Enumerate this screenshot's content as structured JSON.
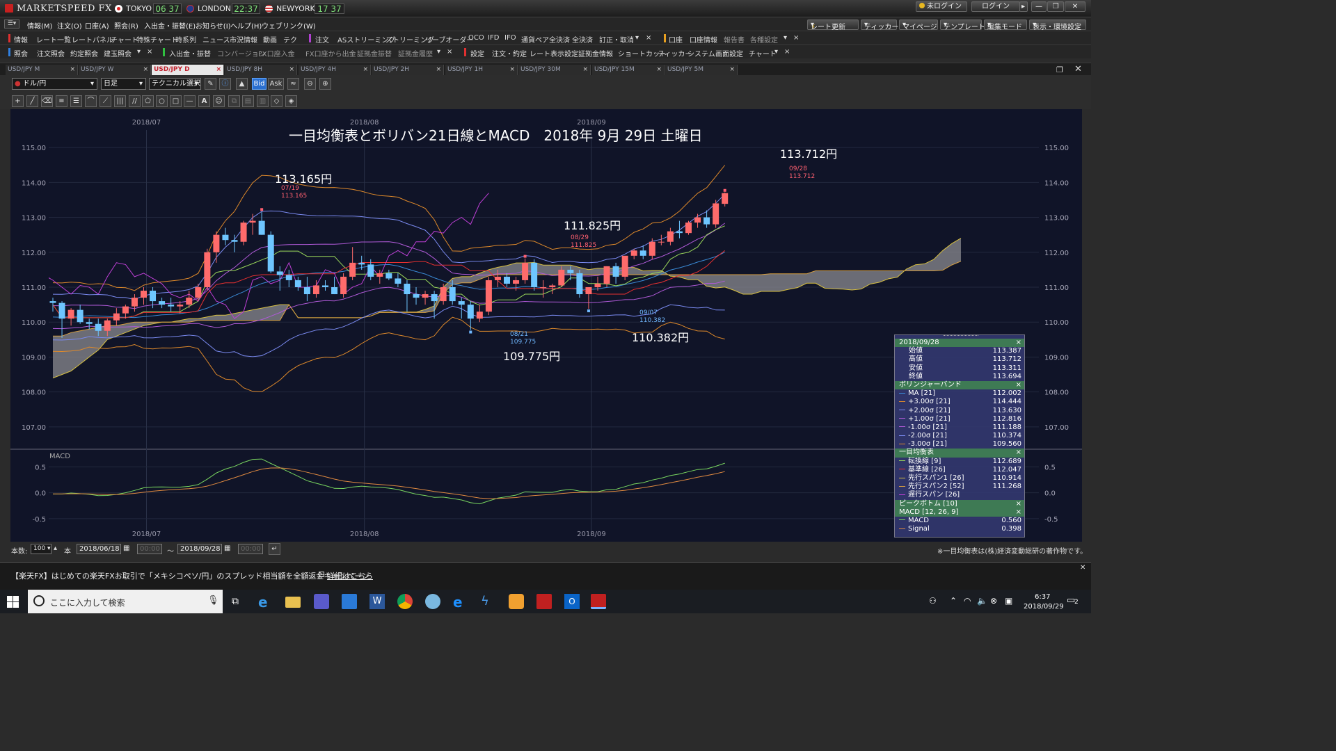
{
  "app": {
    "logo": "MARKETSPEED FX",
    "clocks": [
      {
        "city": "TOKYO",
        "time": "06 37"
      },
      {
        "city": "LONDON",
        "time": "22:37"
      },
      {
        "city": "NEWYORK",
        "time": "17 37"
      }
    ],
    "login_status": "未ログイン",
    "login_button": "ログイン"
  },
  "menubar": [
    "情報(M)",
    "注文(O)",
    "口座(A)",
    "照会(R)",
    "入出金・振替(E)",
    "お知らせ(I)",
    "ヘルプ(H)",
    "ウェブリンク(W)"
  ],
  "menubar_right": [
    "レート更新",
    "ティッカー",
    "マイページ",
    "テンプレート",
    "編集モード",
    "表示・環境設定"
  ],
  "toolbar1": [
    "情報",
    "レート一覧",
    "レートパネル",
    "チャート",
    "特殊チャート",
    "時系列",
    "ニュース",
    "市況情報",
    "動画",
    "テク",
    "注文",
    "ASストリーミング",
    "ストリーミング",
    "リーブオーダー",
    "OCO",
    "IFD",
    "IFO",
    "通貨ペア全決済",
    "全決済",
    "訂正・取消",
    "口座",
    "口座情報",
    "報告書",
    "各種設定"
  ],
  "toolbar2": [
    "照会",
    "注文照会",
    "約定照会",
    "建玉照会",
    "入出金・振替",
    "コンバージョン",
    "FX口座入金",
    "FX口座から出金",
    "証拠金振替",
    "証拠金履歴",
    "設定",
    "注文・約定",
    "レート表示設定",
    "証拠金情報",
    "ショートカット",
    "ティッカー",
    "システム",
    "画面設定",
    "チャート"
  ],
  "tabs": [
    "USD/JPY M",
    "USD/JPY W",
    "USD/JPY D",
    "USD/JPY 8H",
    "USD/JPY 4H",
    "USD/JPY 2H",
    "USD/JPY 1H",
    "USD/JPY 30M",
    "USD/JPY 15M",
    "USD/JPY 5M"
  ],
  "active_tab": "USD/JPY D",
  "controls": {
    "pair": "ドル/円",
    "period": "日足",
    "technical": "テクニカル選択",
    "bid": "Bid",
    "ask": "Ask"
  },
  "chart_title": "一目均衡表とボリバン21日線とMACD　2018年 9月 29日 土曜日",
  "annotations": {
    "high_jul": {
      "big": "113.165円",
      "date": "07/19",
      "value": "113.165"
    },
    "high_aug": {
      "big": "111.825円",
      "date": "08/29",
      "value": "111.825"
    },
    "high_sep": {
      "big": "113.712円",
      "date": "09/28",
      "value": "113.712"
    },
    "low_aug": {
      "big": "109.775円",
      "date": "08/21",
      "value": "109.775"
    },
    "low_sep": {
      "big": "110.382円",
      "date": "09/07",
      "value": "110.382"
    }
  },
  "macd_label": "MACD",
  "footer_note": "※一目均衡表は(株)経済変動総研の著作物です。",
  "bottom": {
    "count_label": "本数:",
    "count": "100",
    "unit": "本",
    "from": "2018/06/18",
    "to": "2018/09/28",
    "time_placeholder": "00:00",
    "tilde": "～"
  },
  "news_ticker": "【楽天FX】はじめての楽天FXお取引で「メキシコペソ/円」のスプレッド相当額を全額返金キャンペーン",
  "news_link": "詳細はこちら",
  "taskbar": {
    "search_placeholder": "ここに入力して検索",
    "time": "6:37",
    "date": "2018/09/29",
    "notif": "2"
  },
  "info_panel": {
    "date": "2018/09/28",
    "ohlc": [
      {
        "label": "始値",
        "value": "113.387"
      },
      {
        "label": "高値",
        "value": "113.712"
      },
      {
        "label": "安値",
        "value": "113.311"
      },
      {
        "label": "終値",
        "value": "113.694"
      }
    ],
    "bb_title": "ボリンジャーバンド",
    "bb": [
      {
        "label": "MA [21]",
        "value": "112.002",
        "color": "#3a8ad6"
      },
      {
        "label": "+3.00σ [21]",
        "value": "114.444",
        "color": "#e08a2a"
      },
      {
        "label": "+2.00σ [21]",
        "value": "113.630",
        "color": "#7a8af0"
      },
      {
        "label": "+1.00σ [21]",
        "value": "112.816",
        "color": "#b05ad8"
      },
      {
        "label": "-1.00σ [21]",
        "value": "111.188",
        "color": "#b05ad8"
      },
      {
        "label": "-2.00σ [21]",
        "value": "110.374",
        "color": "#7a8af0"
      },
      {
        "label": "-3.00σ [21]",
        "value": "109.560",
        "color": "#e08a2a"
      }
    ],
    "ichi_title": "一目均衡表",
    "ichi": [
      {
        "label": "転換線 [9]",
        "value": "112.689",
        "color": "#9ad85a"
      },
      {
        "label": "基準線 [26]",
        "value": "112.047",
        "color": "#e83030"
      },
      {
        "label": "先行スパン1 [26]",
        "value": "110.914",
        "color": "#d8c040"
      },
      {
        "label": "先行スパン2 [52]",
        "value": "111.268",
        "color": "#d8a040"
      },
      {
        "label": "遅行スパン [26]",
        "value": "",
        "color": "#c040d8"
      }
    ],
    "pb_title": "ピークボトム [10]",
    "macd_title": "MACD [12, 26, 9]",
    "macd": [
      {
        "label": "MACD",
        "value": "0.560",
        "color": "#7ad860"
      },
      {
        "label": "Signal",
        "value": "0.398",
        "color": "#e08a40"
      }
    ]
  },
  "chart_data": {
    "type": "candlestick",
    "pair": "USD/JPY",
    "timeframe": "daily",
    "xaxis_labels": [
      "2018/07",
      "2018/08",
      "2018/09"
    ],
    "yaxis_ticks": [
      107.0,
      108.0,
      109.0,
      110.0,
      111.0,
      112.0,
      113.0,
      114.0,
      115.0
    ],
    "ylim": [
      106.5,
      115.5
    ],
    "macd_ticks": [
      0.5,
      0.0,
      -0.5
    ],
    "candles": [
      {
        "d": "06/18",
        "o": 110.6,
        "h": 110.7,
        "l": 110.3,
        "c": 110.55
      },
      {
        "d": "06/19",
        "o": 110.55,
        "h": 110.6,
        "l": 109.55,
        "c": 110.1
      },
      {
        "d": "06/20",
        "o": 110.1,
        "h": 110.4,
        "l": 109.9,
        "c": 110.35
      },
      {
        "d": "06/21",
        "o": 110.35,
        "h": 110.5,
        "l": 109.95,
        "c": 110.0
      },
      {
        "d": "06/22",
        "o": 110.0,
        "h": 110.1,
        "l": 109.8,
        "c": 109.95
      },
      {
        "d": "06/25",
        "o": 109.95,
        "h": 110.1,
        "l": 109.6,
        "c": 109.75
      },
      {
        "d": "06/26",
        "o": 109.75,
        "h": 110.1,
        "l": 109.6,
        "c": 110.05
      },
      {
        "d": "06/27",
        "o": 110.05,
        "h": 110.4,
        "l": 109.9,
        "c": 110.25
      },
      {
        "d": "06/28",
        "o": 110.25,
        "h": 110.5,
        "l": 110.1,
        "c": 110.45
      },
      {
        "d": "06/29",
        "o": 110.45,
        "h": 110.8,
        "l": 110.3,
        "c": 110.7
      },
      {
        "d": "07/02",
        "o": 110.7,
        "h": 111.0,
        "l": 110.5,
        "c": 110.9
      },
      {
        "d": "07/03",
        "o": 110.9,
        "h": 111.0,
        "l": 110.4,
        "c": 110.6
      },
      {
        "d": "07/04",
        "o": 110.6,
        "h": 110.7,
        "l": 110.4,
        "c": 110.5
      },
      {
        "d": "07/05",
        "o": 110.5,
        "h": 110.7,
        "l": 110.3,
        "c": 110.45
      },
      {
        "d": "07/06",
        "o": 110.45,
        "h": 110.6,
        "l": 110.25,
        "c": 110.5
      },
      {
        "d": "07/09",
        "o": 110.5,
        "h": 110.9,
        "l": 110.4,
        "c": 110.7
      },
      {
        "d": "07/10",
        "o": 110.7,
        "h": 111.1,
        "l": 110.6,
        "c": 111.0
      },
      {
        "d": "07/11",
        "o": 111.0,
        "h": 112.1,
        "l": 110.9,
        "c": 112.0
      },
      {
        "d": "07/12",
        "o": 112.0,
        "h": 112.6,
        "l": 111.7,
        "c": 112.5
      },
      {
        "d": "07/13",
        "o": 112.5,
        "h": 112.7,
        "l": 112.2,
        "c": 112.35
      },
      {
        "d": "07/16",
        "o": 112.35,
        "h": 112.5,
        "l": 112.0,
        "c": 112.3
      },
      {
        "d": "07/17",
        "o": 112.3,
        "h": 112.9,
        "l": 112.2,
        "c": 112.85
      },
      {
        "d": "07/18",
        "o": 112.85,
        "h": 113.1,
        "l": 112.5,
        "c": 112.9
      },
      {
        "d": "07/19",
        "o": 112.9,
        "h": 113.165,
        "l": 112.5,
        "c": 112.5
      },
      {
        "d": "07/20",
        "o": 112.5,
        "h": 112.6,
        "l": 111.4,
        "c": 111.45
      },
      {
        "d": "07/23",
        "o": 111.45,
        "h": 111.6,
        "l": 110.9,
        "c": 111.35
      },
      {
        "d": "07/24",
        "o": 111.35,
        "h": 111.5,
        "l": 111.0,
        "c": 111.2
      },
      {
        "d": "07/25",
        "o": 111.2,
        "h": 111.3,
        "l": 110.9,
        "c": 111.0
      },
      {
        "d": "07/26",
        "o": 111.0,
        "h": 111.3,
        "l": 110.6,
        "c": 110.8
      },
      {
        "d": "07/27",
        "o": 110.8,
        "h": 111.2,
        "l": 110.7,
        "c": 111.05
      },
      {
        "d": "07/30",
        "o": 111.05,
        "h": 111.2,
        "l": 110.9,
        "c": 111.0
      },
      {
        "d": "07/31",
        "o": 111.0,
        "h": 111.3,
        "l": 110.8,
        "c": 110.8
      },
      {
        "d": "08/01",
        "o": 110.8,
        "h": 111.4,
        "l": 110.7,
        "c": 111.3
      },
      {
        "d": "08/02",
        "o": 111.3,
        "h": 112.15,
        "l": 111.2,
        "c": 111.7
      },
      {
        "d": "08/03",
        "o": 111.7,
        "h": 111.9,
        "l": 111.5,
        "c": 111.65
      },
      {
        "d": "08/06",
        "o": 111.65,
        "h": 111.8,
        "l": 111.2,
        "c": 111.3
      },
      {
        "d": "08/07",
        "o": 111.3,
        "h": 111.5,
        "l": 111.1,
        "c": 111.4
      },
      {
        "d": "08/08",
        "o": 111.4,
        "h": 111.5,
        "l": 111.2,
        "c": 111.25
      },
      {
        "d": "08/09",
        "o": 111.25,
        "h": 111.4,
        "l": 111.0,
        "c": 111.1
      },
      {
        "d": "08/10",
        "o": 111.1,
        "h": 111.2,
        "l": 110.3,
        "c": 110.8
      },
      {
        "d": "08/13",
        "o": 110.8,
        "h": 111.0,
        "l": 110.5,
        "c": 110.7
      },
      {
        "d": "08/14",
        "o": 110.7,
        "h": 110.9,
        "l": 110.5,
        "c": 110.8
      },
      {
        "d": "08/15",
        "o": 110.8,
        "h": 110.9,
        "l": 110.1,
        "c": 110.6
      },
      {
        "d": "08/16",
        "o": 110.6,
        "h": 111.1,
        "l": 110.5,
        "c": 111.0
      },
      {
        "d": "08/17",
        "o": 111.0,
        "h": 111.2,
        "l": 110.5,
        "c": 110.6
      },
      {
        "d": "08/20",
        "o": 110.6,
        "h": 110.7,
        "l": 110.1,
        "c": 110.5
      },
      {
        "d": "08/21",
        "o": 110.5,
        "h": 110.6,
        "l": 109.775,
        "c": 110.1
      },
      {
        "d": "08/22",
        "o": 110.1,
        "h": 110.5,
        "l": 110.0,
        "c": 110.3
      },
      {
        "d": "08/23",
        "o": 110.3,
        "h": 111.3,
        "l": 110.2,
        "c": 111.2
      },
      {
        "d": "08/24",
        "o": 111.2,
        "h": 111.5,
        "l": 111.0,
        "c": 111.3
      },
      {
        "d": "08/27",
        "o": 111.3,
        "h": 111.4,
        "l": 111.0,
        "c": 111.1
      },
      {
        "d": "08/28",
        "o": 111.1,
        "h": 111.3,
        "l": 110.9,
        "c": 111.2
      },
      {
        "d": "08/29",
        "o": 111.2,
        "h": 111.825,
        "l": 111.1,
        "c": 111.7
      },
      {
        "d": "08/30",
        "o": 111.7,
        "h": 111.8,
        "l": 110.9,
        "c": 111.0
      },
      {
        "d": "08/31",
        "o": 111.0,
        "h": 111.2,
        "l": 110.7,
        "c": 111.0
      },
      {
        "d": "09/03",
        "o": 111.0,
        "h": 111.1,
        "l": 110.8,
        "c": 111.05
      },
      {
        "d": "09/04",
        "o": 111.05,
        "h": 111.6,
        "l": 111.0,
        "c": 111.5
      },
      {
        "d": "09/05",
        "o": 111.5,
        "h": 111.6,
        "l": 111.2,
        "c": 111.4
      },
      {
        "d": "09/06",
        "o": 111.4,
        "h": 111.5,
        "l": 110.7,
        "c": 110.8
      },
      {
        "d": "09/07",
        "o": 110.8,
        "h": 111.0,
        "l": 110.382,
        "c": 111.0
      },
      {
        "d": "09/10",
        "o": 111.0,
        "h": 111.3,
        "l": 110.9,
        "c": 111.1
      },
      {
        "d": "09/11",
        "o": 111.1,
        "h": 111.6,
        "l": 111.0,
        "c": 111.6
      },
      {
        "d": "09/12",
        "o": 111.6,
        "h": 111.7,
        "l": 111.1,
        "c": 111.3
      },
      {
        "d": "09/13",
        "o": 111.3,
        "h": 111.8,
        "l": 111.2,
        "c": 111.9
      },
      {
        "d": "09/14",
        "o": 111.9,
        "h": 112.1,
        "l": 111.8,
        "c": 112.05
      },
      {
        "d": "09/17",
        "o": 112.05,
        "h": 112.2,
        "l": 111.8,
        "c": 111.9
      },
      {
        "d": "09/18",
        "o": 111.9,
        "h": 112.4,
        "l": 111.8,
        "c": 112.3
      },
      {
        "d": "09/19",
        "o": 112.3,
        "h": 112.5,
        "l": 112.2,
        "c": 112.3
      },
      {
        "d": "09/20",
        "o": 112.3,
        "h": 112.7,
        "l": 112.2,
        "c": 112.6
      },
      {
        "d": "09/21",
        "o": 112.6,
        "h": 112.9,
        "l": 112.4,
        "c": 112.55
      },
      {
        "d": "09/24",
        "o": 112.55,
        "h": 112.9,
        "l": 112.5,
        "c": 112.85
      },
      {
        "d": "09/25",
        "o": 112.85,
        "h": 113.1,
        "l": 112.7,
        "c": 113.0
      },
      {
        "d": "09/26",
        "o": 113.0,
        "h": 113.2,
        "l": 112.7,
        "c": 112.8
      },
      {
        "d": "09/27",
        "o": 112.8,
        "h": 113.5,
        "l": 112.7,
        "c": 113.4
      },
      {
        "d": "09/28",
        "o": 113.387,
        "h": 113.712,
        "l": 113.311,
        "c": 113.694
      }
    ]
  }
}
